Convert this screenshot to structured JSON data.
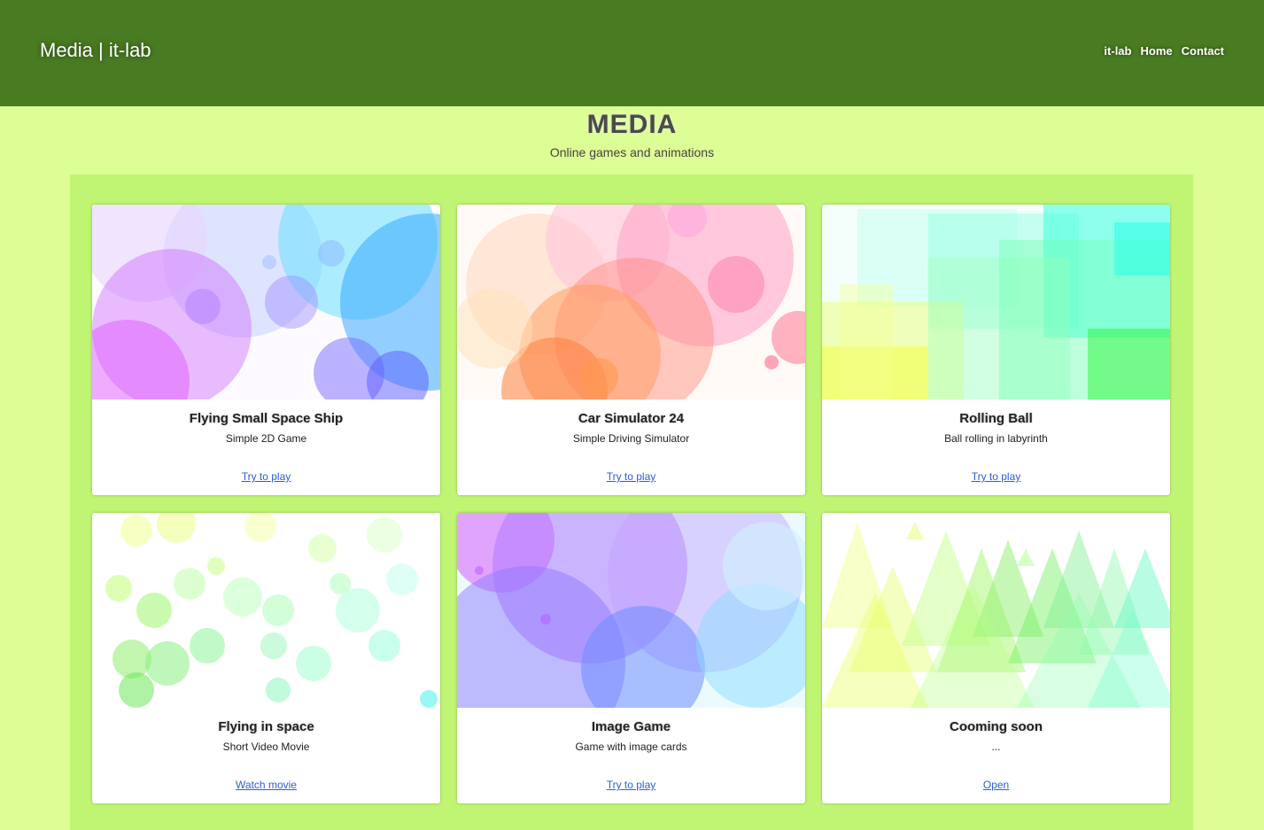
{
  "header": {
    "brand": "Media | it-lab",
    "nav": [
      "it-lab",
      "Home",
      "Contact"
    ]
  },
  "page": {
    "title": "MEDIA",
    "subtitle": "Online games and animations"
  },
  "cards": [
    {
      "title": "Flying Small Space Ship",
      "desc": "Simple 2D Game",
      "link": "Try to play"
    },
    {
      "title": "Car Simulator 24",
      "desc": "Simple Driving Simulator",
      "link": "Try to play"
    },
    {
      "title": "Rolling Ball",
      "desc": "Ball rolling in labyrinth",
      "link": "Try to play"
    },
    {
      "title": "Flying in space",
      "desc": "Short Video Movie",
      "link": "Watch movie"
    },
    {
      "title": "Image Game",
      "desc": "Game with image cards",
      "link": "Try to play"
    },
    {
      "title": "Cooming soon",
      "desc": "...",
      "link": "Open"
    }
  ],
  "colors": {
    "header_bg": "#497b22",
    "page_bg": "#ddfd95",
    "panel_bg": "#c0f574",
    "link": "#2b5fd9"
  }
}
